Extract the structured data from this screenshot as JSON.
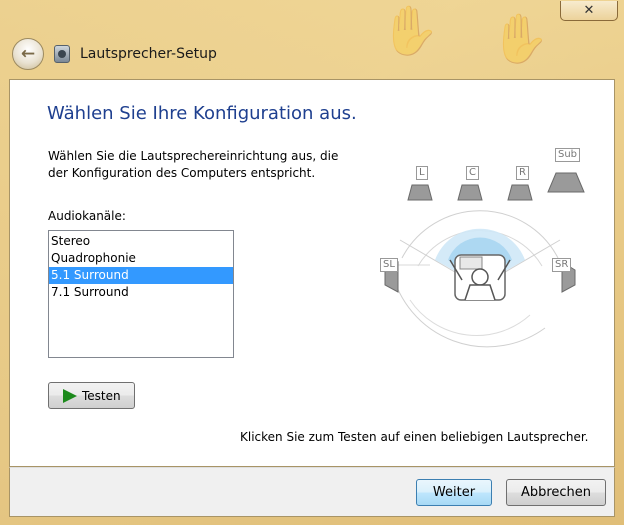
{
  "window": {
    "title": "Lautsprecher-Setup",
    "close_glyph": "✕",
    "back_glyph": "←"
  },
  "page": {
    "heading": "Wählen Sie Ihre Konfiguration aus.",
    "description": "Wählen Sie die Lautsprechereinrichtung aus, die der Konfiguration des Computers entspricht.",
    "list_label": "Audiokanäle:",
    "channels": [
      {
        "label": "Stereo",
        "selected": false
      },
      {
        "label": "Quadrophonie",
        "selected": false
      },
      {
        "label": "5.1 Surround",
        "selected": true
      },
      {
        "label": "7.1 Surround",
        "selected": false
      }
    ],
    "test_button": "Testen",
    "hint": "Klicken Sie zum Testen auf einen beliebigen Lautsprecher."
  },
  "speakers": {
    "front_left": "L",
    "center": "C",
    "front_right": "R",
    "subwoofer": "Sub",
    "surround_left": "SL",
    "surround_right": "SR"
  },
  "footer": {
    "next": "Weiter",
    "cancel": "Abbrechen"
  },
  "colors": {
    "heading": "#1e3f8f",
    "selection": "#3399ff",
    "play": "#1c8a1c"
  }
}
